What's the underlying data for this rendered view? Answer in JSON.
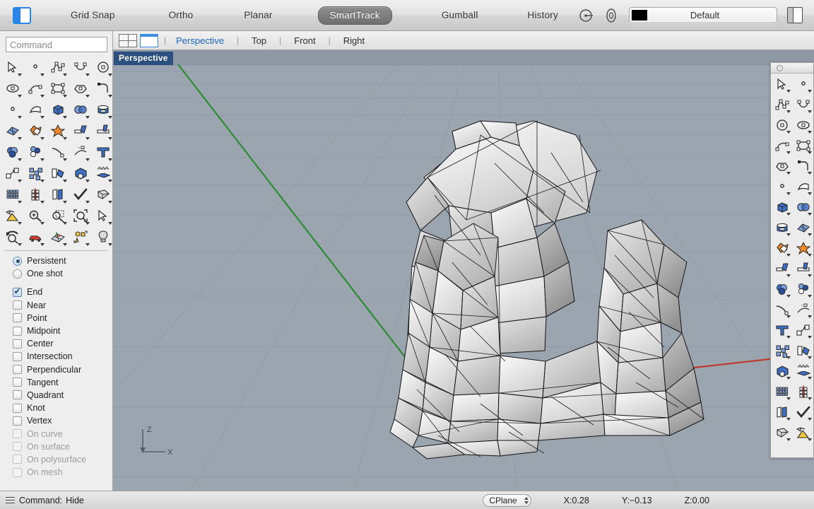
{
  "topbar": {
    "sidebar_toggle": "sidebar-toggle",
    "items": [
      {
        "label": "Grid Snap",
        "active": false
      },
      {
        "label": "Ortho",
        "active": false
      },
      {
        "label": "Planar",
        "active": false
      },
      {
        "label": "SmartTrack",
        "active": true
      },
      {
        "label": "Gumball",
        "active": false
      },
      {
        "label": "History",
        "active": false
      }
    ],
    "layer": {
      "name": "Default",
      "swatch_color": "#000000"
    },
    "accent_color": "#2a86e8"
  },
  "viewport_tabs": {
    "layouts": [
      "four-view-layout-icon",
      "single-view-layout-icon"
    ],
    "tabs": [
      {
        "label": "Perspective",
        "active": true
      },
      {
        "label": "Top",
        "active": false
      },
      {
        "label": "Front",
        "active": false
      },
      {
        "label": "Right",
        "active": false
      }
    ],
    "separator": "|"
  },
  "command": {
    "placeholder": "Command",
    "value": ""
  },
  "left_toolbar": {
    "icons": [
      "select-arrow-icon",
      "point-icon",
      "polyline-icon",
      "curve-icon",
      "circle-icon",
      "ellipse-icon",
      "arc-icon",
      "rectangle-icon",
      "polygon-icon",
      "fillet-curve-icon",
      "surface-from-points-icon",
      "loft-surface-icon",
      "box-icon",
      "sphere-icon",
      "cylinder-surface-icon",
      "surface-array-icon",
      "boolean-union-icon",
      "explode-icon",
      "trim-icon",
      "split-icon",
      "boolean-difference-icon",
      "boolean-intersection-icon",
      "offset-curve-icon",
      "dimension-icon",
      "text-icon",
      "move-icon",
      "copy-icon",
      "mirror-icon",
      "box-edit-icon",
      "extrude-icon",
      "array-icon",
      "array-polar-icon",
      "rotate-icon",
      "check-icon",
      "cap-icon",
      "render-icon",
      "zoom-in-icon",
      "zoom-window-icon",
      "zoom-extents-icon",
      "zoom-selected-icon",
      "undo-view-icon",
      "car-perspective-icon",
      "cplane-grid-icon",
      "layer-objects-icon",
      "light-bulb-icon"
    ]
  },
  "snap_panel": {
    "modes": [
      {
        "label": "Persistent",
        "type": "radio",
        "checked": true,
        "enabled": true
      },
      {
        "label": "One shot",
        "type": "radio",
        "checked": false,
        "enabled": true
      }
    ],
    "snaps": [
      {
        "label": "End",
        "checked": true,
        "enabled": true
      },
      {
        "label": "Near",
        "checked": false,
        "enabled": true
      },
      {
        "label": "Point",
        "checked": false,
        "enabled": true
      },
      {
        "label": "Midpoint",
        "checked": false,
        "enabled": true
      },
      {
        "label": "Center",
        "checked": false,
        "enabled": true
      },
      {
        "label": "Intersection",
        "checked": false,
        "enabled": true
      },
      {
        "label": "Perpendicular",
        "checked": false,
        "enabled": true
      },
      {
        "label": "Tangent",
        "checked": false,
        "enabled": true
      },
      {
        "label": "Quadrant",
        "checked": false,
        "enabled": true
      },
      {
        "label": "Knot",
        "checked": false,
        "enabled": true
      },
      {
        "label": "Vertex",
        "checked": false,
        "enabled": true
      },
      {
        "label": "On curve",
        "checked": false,
        "enabled": false
      },
      {
        "label": "On surface",
        "checked": false,
        "enabled": false
      },
      {
        "label": "On polysurface",
        "checked": false,
        "enabled": false
      },
      {
        "label": "On mesh",
        "checked": false,
        "enabled": false
      }
    ]
  },
  "viewport": {
    "label": "Perspective",
    "background_color": "#9aa5b0",
    "grid_color": "#8c97a3",
    "x_axis_color": "#c0392b",
    "y_axis_color": "#2e8b33",
    "axis_indicator": {
      "z_label": "Z",
      "x_label": "X"
    },
    "model": {
      "name": "triangulated-mesh-rock",
      "shading": "shaded-wireframe",
      "edge_color": "#1a1a1a",
      "fill_light": "#f2f2f2",
      "fill_dark": "#9c9c9c"
    }
  },
  "right_toolbar": {
    "title": "tool-palette",
    "icons": [
      "select-arrow-icon",
      "point-icon",
      "polyline-icon",
      "curve-icon",
      "circle-icon",
      "ellipse-icon",
      "arc-icon",
      "rectangle-icon",
      "polygon-icon",
      "fillet-curve-icon",
      "surface-from-points-icon",
      "loft-surface-icon",
      "box-icon",
      "sphere-icon",
      "cylinder-surface-icon",
      "surface-array-icon",
      "boolean-union-icon",
      "explode-icon",
      "trim-icon",
      "split-icon",
      "boolean-difference-icon",
      "boolean-intersection-icon",
      "offset-curve-icon",
      "dimension-icon",
      "text-icon",
      "move-icon",
      "copy-icon",
      "mirror-icon",
      "box-edit-icon",
      "extrude-icon",
      "array-icon",
      "array-polar-icon",
      "rotate-icon",
      "check-icon",
      "cap-icon",
      "render-icon"
    ]
  },
  "statusbar": {
    "menu_icon": "hamburger-icon",
    "command_label": "Command:",
    "command_value": "Hide",
    "cplane": "CPlane",
    "coords": {
      "x": "X:0.28",
      "y": "Y:−0.13",
      "z": "Z:0.00"
    }
  }
}
